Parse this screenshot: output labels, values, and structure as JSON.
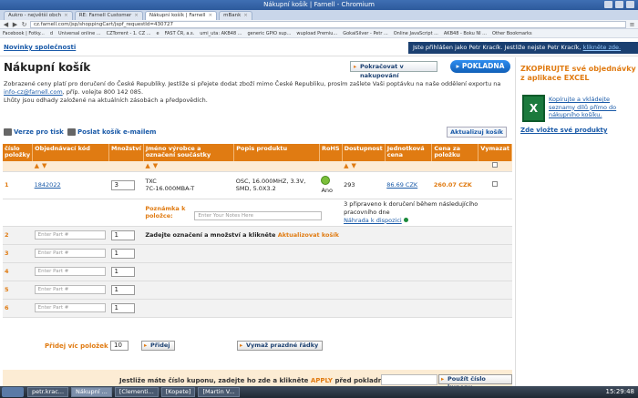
{
  "window": {
    "title": "Nákupní košík | Farnell - Chromium"
  },
  "tabs": [
    {
      "label": "Aukro - největší obch",
      "active": false
    },
    {
      "label": "RE: Farnell Customer",
      "active": false
    },
    {
      "label": "Nákupní košík | Farnell",
      "active": true
    },
    {
      "label": "mBank",
      "active": false
    }
  ],
  "address": {
    "url": "cz.farnell.com/jsp/shoppingCart/jspf_requestId=430727"
  },
  "bookmarks": [
    "Facebook | Fotky...",
    "d",
    "Universal online ...",
    "CZTorrent - 1. CZ ...",
    "e",
    "FAST ČR, a.s.",
    "umi_uta: AKB48 ...",
    "generic GPIO sup...",
    "wupload Premiu...",
    "GokaiSilver - Petr ...",
    "Online JavaScript ...",
    "AKB48 - Boku NI ...",
    "Other Bookmarks"
  ],
  "topstrip": {
    "news": "Novinky společnosti",
    "logged_text": "Jste přihlášen jako Petr Kracík. Jestliže nejste Petr Kracík,",
    "logged_link": "klikněte zde."
  },
  "header": {
    "title": "Nákupní košík",
    "continue": "Pokračovat v nakupování",
    "order": "POKLADNA"
  },
  "intro": {
    "line1": "Zobrazené ceny platí pro doručení do České Republiky. Jestliže si přejete dodat zboží mimo České Republiku, prosím zašlete Vaši poptávku na naše oddělení exportu na",
    "email": "info-cz@farnell.com",
    "line2": ", příp. volejte 800 142 085.",
    "line3": "Lhůty jsou odhady založené na aktuálních zásobách a předpovědích."
  },
  "actions": {
    "print": "Verze pro tisk",
    "email": "Poslat košík e-mailem",
    "update": "Aktualizuj košík"
  },
  "table": {
    "headers": [
      "číslo položky",
      "Objednávací kód",
      "Množství",
      "Jméno výrobce a označení součástky",
      "Popis produktu",
      "RoHS",
      "Dostupnost",
      "Jednotková cena",
      "Cena za položku",
      "Vymazat"
    ],
    "item": {
      "num": "1",
      "code": "1842022",
      "qty": "3",
      "manufacturer": "TXC",
      "part": "7C-16.000MBA-T",
      "description": "OSC, 16.000MHZ, 3.3V, SMD, 5.0X3.2",
      "rohs": "Ano",
      "availability": "293",
      "unit_price": "86.69 CZK",
      "total": "260.07 CZK",
      "note_label": "Poznámka k položce:",
      "note_placeholder": "Enter Your Notes Here",
      "delivery": "3 připraveno k doručení během následujícího pracovního dne",
      "replacement": "Náhrada k dispozici"
    },
    "empty_rows": [
      "2",
      "3",
      "4",
      "5",
      "6"
    ],
    "part_placeholder": "Enter Part #",
    "empty_qty": "1",
    "entry_hint": "Zadejte označení a množství a klikněte",
    "entry_hint_link": "Aktualizovat košík"
  },
  "footer": {
    "more_label": "Přidej víc položek",
    "more_qty": "10",
    "add_btn": "Přidej",
    "clear_btn": "Vymaž prazdné řádky"
  },
  "coupon": {
    "text1": "Jestliže máte číslo kuponu, zadejte ho zde a klikněte",
    "apply": "APPLY",
    "text2": "před pokladnou",
    "button": "Použít číslo kuponu"
  },
  "sidebar": {
    "title": "ZKOPÍRUJTE své objednávky z aplikace EXCEL",
    "desc": "Kopírujte a vkládejte seznamy dílů přímo do nákupního košíku.",
    "here": "Zde vložte své produkty",
    "xl_icon": "X"
  },
  "taskbar": {
    "items": [
      "petr.krac...",
      "Nákupní ...",
      "[Clementi...",
      "[Kopete]",
      "[Martin V..."
    ],
    "active": 1,
    "clock": "15:29:48"
  }
}
